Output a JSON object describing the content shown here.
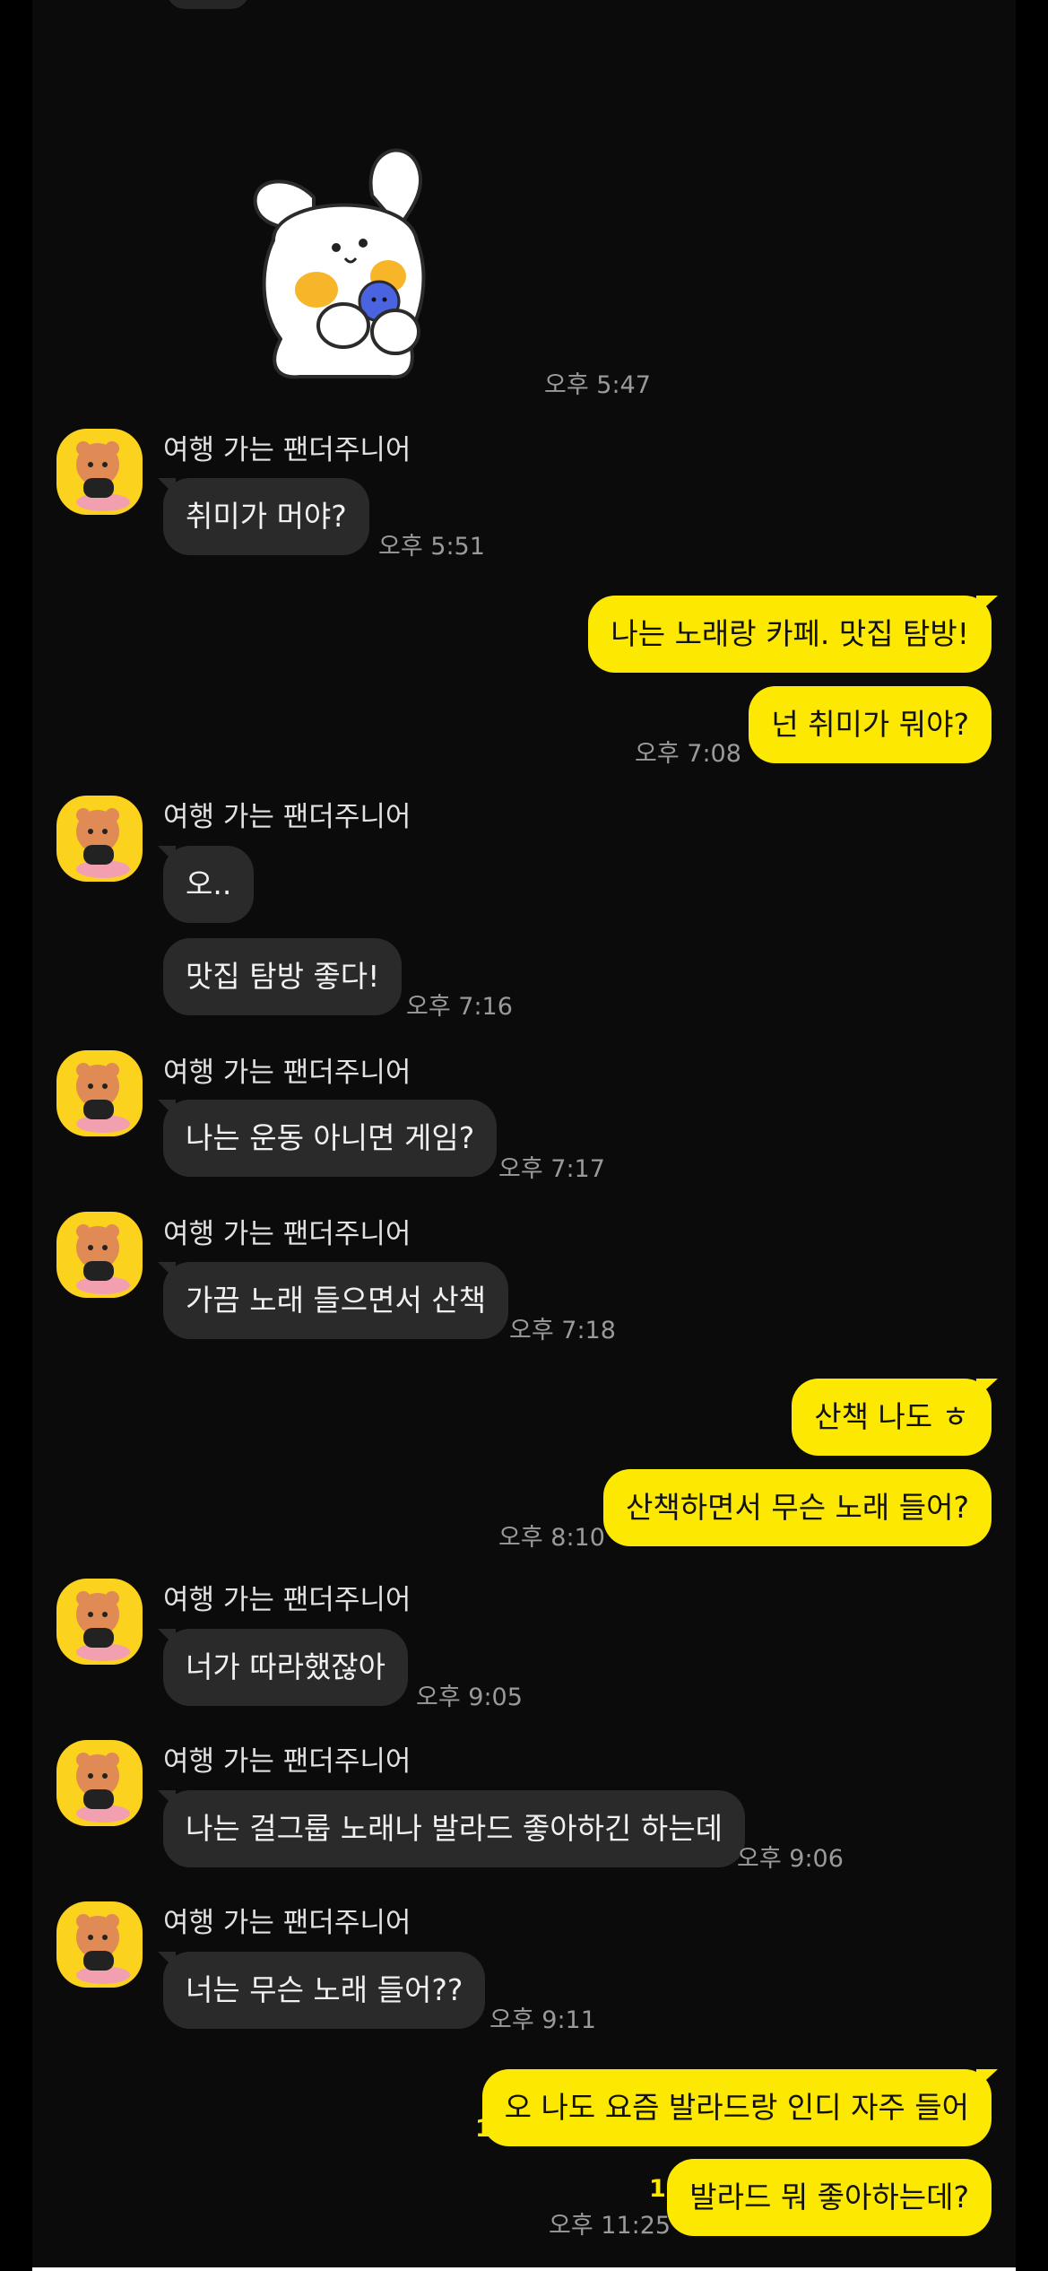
{
  "chat": {
    "sender_name": "여행 가는 팬더주니어",
    "sticker_time": "오후 5:47",
    "groups": [
      {
        "side": "in",
        "time": "오후 5:51",
        "messages": [
          "취미가 머야?"
        ]
      },
      {
        "side": "out",
        "time": "오후 7:08",
        "messages": [
          "나는 노래랑 카페. 맛집 탐방!",
          "넌 취미가 뭐야?"
        ]
      },
      {
        "side": "in",
        "time": "오후 7:16",
        "messages": [
          "오..",
          "맛집 탐방 좋다!"
        ]
      },
      {
        "side": "in",
        "time": "오후 7:17",
        "messages": [
          "나는 운동 아니면 게임?"
        ]
      },
      {
        "side": "in",
        "time": "오후 7:18",
        "messages": [
          "가끔 노래 들으면서 산책"
        ]
      },
      {
        "side": "out",
        "time": "오후 8:10",
        "messages": [
          "산책 나도 ㅎ",
          "산책하면서 무슨 노래 들어?"
        ]
      },
      {
        "side": "in",
        "time": "오후 9:05",
        "messages": [
          "너가 따라했잖아"
        ]
      },
      {
        "side": "in",
        "time": "오후 9:06",
        "messages": [
          "나는 걸그룹 노래나 발라드 좋아하긴 하는데"
        ]
      },
      {
        "side": "in",
        "time": "오후 9:11",
        "messages": [
          "너는 무슨 노래 들어??"
        ]
      },
      {
        "side": "out",
        "time": "오후 11:25",
        "messages": [
          "오 나도 요즘 발라드랑 인디 자주 들어",
          "발라드 뭐 좋아하는데?"
        ],
        "unread": [
          "1",
          "1"
        ]
      }
    ]
  },
  "colors": {
    "background": "#0b0b0b",
    "incoming_bubble": "#2a2a2a",
    "outgoing_bubble": "#fce800",
    "avatar_bg": "#fbd31e",
    "unread_count": "#fce800"
  },
  "icons": {
    "avatar": "panda-junior-avatar-icon",
    "sticker": "white-bunny-sticker"
  }
}
